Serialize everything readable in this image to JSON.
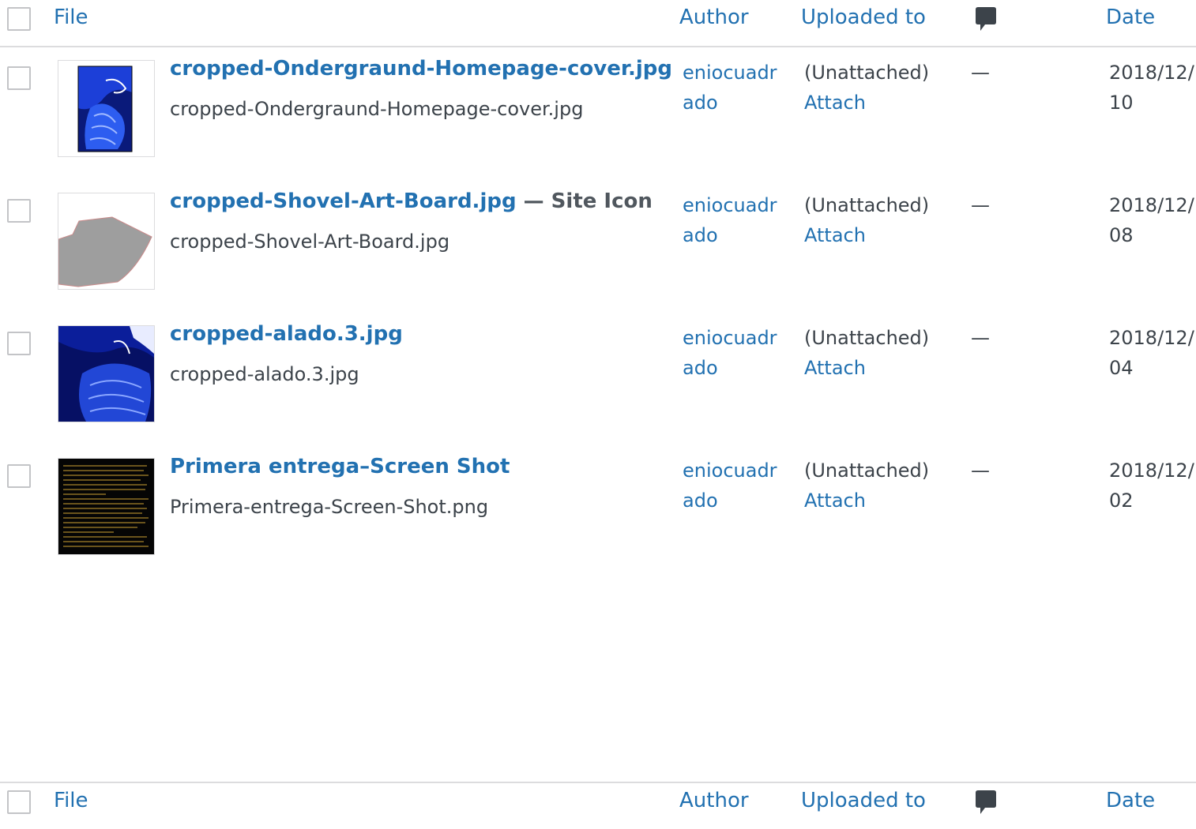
{
  "header": {
    "file": "File",
    "author": "Author",
    "uploaded_to": "Uploaded to",
    "comments_icon": "comment-bubble-icon",
    "date": "Date"
  },
  "rows": [
    {
      "title": "cropped-Ondergraund-Homepage-cover.jpg",
      "state": "",
      "filename": "cropped-Ondergraund-Homepage-cover.jpg",
      "author": "eniocuadrado",
      "uploaded_to": "(Unattached)",
      "attach": "Attach",
      "comments": "—",
      "date": "2018/12/10",
      "thumbnail": "blue-figure-portrait-thumbnail"
    },
    {
      "title": "cropped-Shovel-Art-Board.jpg",
      "state": " — Site Icon",
      "filename": "cropped-Shovel-Art-Board.jpg",
      "author": "eniocuadrado",
      "uploaded_to": "(Unattached)",
      "attach": "Attach",
      "comments": "—",
      "date": "2018/12/08",
      "thumbnail": "gray-shovel-thumbnail"
    },
    {
      "title": "cropped-alado.3.jpg",
      "state": "",
      "filename": "cropped-alado.3.jpg",
      "author": "eniocuadrado",
      "uploaded_to": "(Unattached)",
      "attach": "Attach",
      "comments": "—",
      "date": "2018/12/04",
      "thumbnail": "blue-winged-figure-thumbnail"
    },
    {
      "title": "Primera entrega–Screen Shot",
      "state": "",
      "filename": "Primera-entrega-Screen-Shot.png",
      "author": "eniocuadrado",
      "uploaded_to": "(Unattached)",
      "attach": "Attach",
      "comments": "—",
      "date": "2018/12/02",
      "thumbnail": "dark-text-screenshot-thumbnail"
    }
  ],
  "colors": {
    "link": "#2271b1",
    "text": "#3c434a",
    "border": "#dcdcde"
  }
}
